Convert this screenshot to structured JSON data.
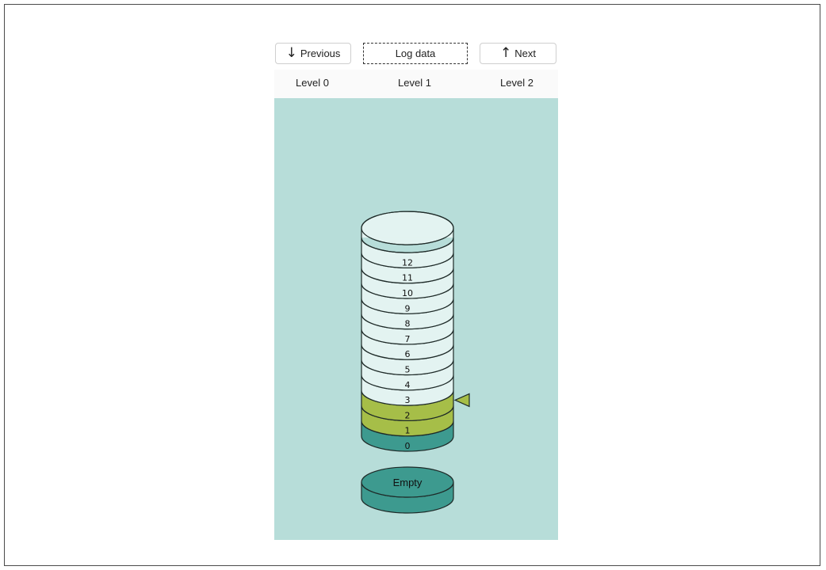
{
  "toolbar": {
    "previous_label": "Previous",
    "log_label": "Log data",
    "next_label": "Next"
  },
  "levels": [
    "Level 0",
    "Level 1",
    "Level 2"
  ],
  "stack": {
    "disks": [
      "0",
      "1",
      "2",
      "3",
      "4",
      "5",
      "6",
      "7",
      "8",
      "9",
      "10",
      "11",
      "12"
    ],
    "highlighted": [
      "1",
      "2"
    ],
    "base": [
      "0"
    ],
    "pointer_at": "2"
  },
  "empty_disk": {
    "label": "Empty"
  },
  "colors": {
    "panel": "#b7ddd9",
    "disk_light": "#e3f3f1",
    "disk_highlight": "#a6be48",
    "disk_base": "#3d9a8f"
  }
}
